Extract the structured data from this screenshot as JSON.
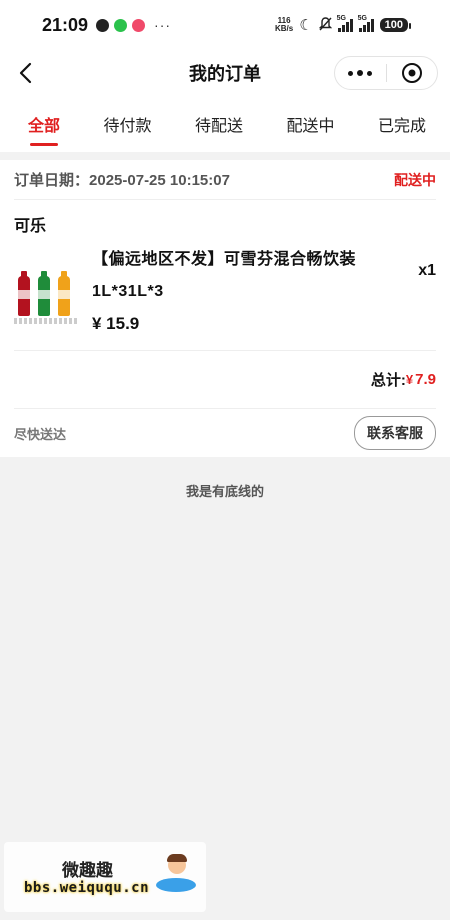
{
  "status_bar": {
    "time": "21:09",
    "net_speed_value": "116",
    "net_speed_unit": "KB/s",
    "signal_1": "5G",
    "signal_2": "5G",
    "battery": "100",
    "more": "···"
  },
  "nav": {
    "title": "我的订单"
  },
  "tabs": [
    {
      "label": "全部",
      "active": true
    },
    {
      "label": "待付款",
      "active": false
    },
    {
      "label": "待配送",
      "active": false
    },
    {
      "label": "配送中",
      "active": false
    },
    {
      "label": "已完成",
      "active": false
    }
  ],
  "order": {
    "date_label": "订单日期：",
    "date_value": "2025-07-25  10:15:07",
    "status": "配送中",
    "shop_name": "可乐",
    "product": {
      "name_line1": "【偏远地区不发】可雪芬混合畅饮装",
      "name_line2": "1L*31L*3",
      "price": "¥ 15.9",
      "quantity": "x1"
    },
    "total_label": "总计:",
    "total_currency": "¥",
    "total_value": "7.9",
    "foot_note": "尽快送达",
    "contact_button": "联系客服"
  },
  "end_text": "我是有底线的",
  "watermark": {
    "title": "微趣趣",
    "url": "bbs.weiququ.cn"
  },
  "colors": {
    "accent": "#e02020",
    "background": "#f2f2f2"
  }
}
